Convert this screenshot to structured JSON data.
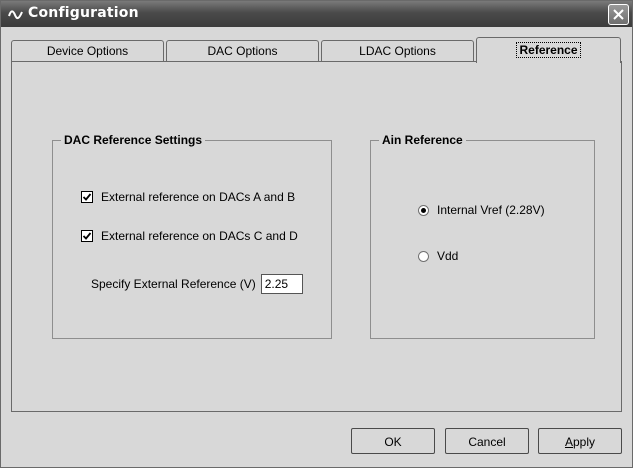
{
  "window": {
    "title": "Configuration",
    "close_label": "×"
  },
  "tabs": [
    {
      "label": "Device Options",
      "selected": false
    },
    {
      "label": "DAC Options",
      "selected": false
    },
    {
      "label": "LDAC Options",
      "selected": false
    },
    {
      "label": "Reference",
      "selected": true
    }
  ],
  "dac_reference": {
    "title": "DAC Reference Settings",
    "ext_ref_ab": {
      "label": "External reference on DACs A and B",
      "checked": true
    },
    "ext_ref_cd": {
      "label": "External reference on DACs C and D",
      "checked": true
    },
    "specify_label": "Specify External Reference (V)",
    "specify_value": "2.25"
  },
  "ain_reference": {
    "title": "Ain Reference",
    "options": [
      {
        "label": "Internal Vref (2.28V)",
        "checked": true
      },
      {
        "label": "Vdd",
        "checked": false
      }
    ]
  },
  "buttons": {
    "ok": "OK",
    "cancel": "Cancel",
    "apply_first": "A",
    "apply_rest": "pply"
  },
  "colors": {
    "titlebar": "#4a4a4a",
    "window_bg": "#d8d8d8"
  },
  "icons": {
    "title": "app-wave-icon",
    "close": "close-icon",
    "checkmark": "checkmark-icon"
  }
}
